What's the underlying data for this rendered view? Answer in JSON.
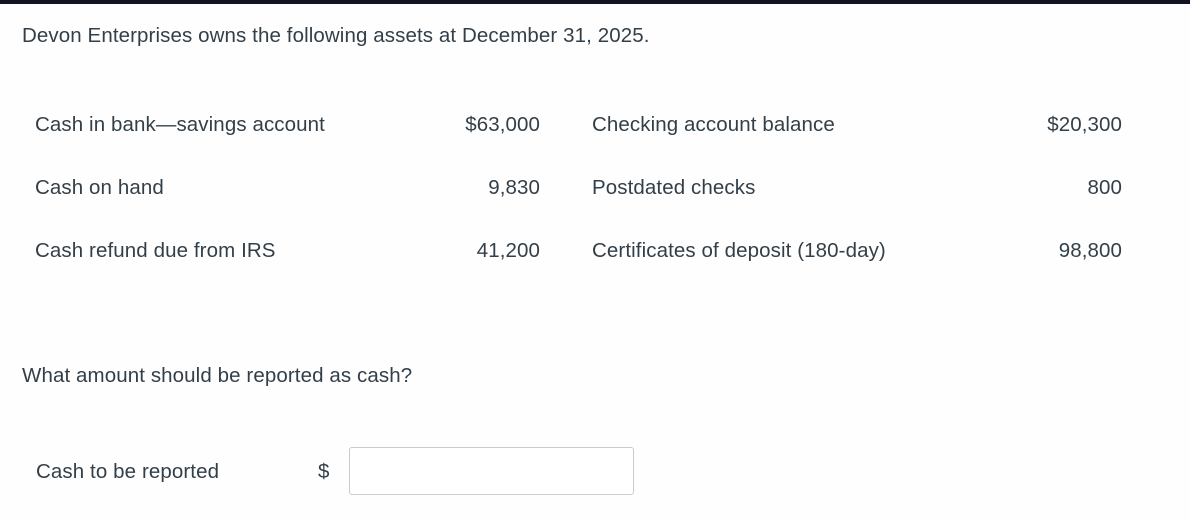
{
  "theme": {
    "top_bar_color": "#12141f",
    "background_color": "#fefefe",
    "text_color": "#333f48",
    "input_border_color": "#c9cccf"
  },
  "prompt": {
    "text": "Devon Enterprises owns the following assets at December 31, 2025."
  },
  "asset_table": {
    "rows": [
      {
        "left_label": "Cash in bank—savings account",
        "left_value": "$63,000",
        "right_label": "Checking account balance",
        "right_value": "$20,300"
      },
      {
        "left_label": "Cash on hand",
        "left_value": "9,830",
        "right_label": "Postdated checks",
        "right_value": "800"
      },
      {
        "left_label": "Cash refund due from IRS",
        "left_value": "41,200",
        "right_label": "Certificates of deposit (180-day)",
        "right_value": "98,800"
      }
    ]
  },
  "question": {
    "text": "What amount should be reported as cash?"
  },
  "answer": {
    "label": "Cash to be reported",
    "currency_symbol": "$",
    "value": "",
    "placeholder": ""
  }
}
